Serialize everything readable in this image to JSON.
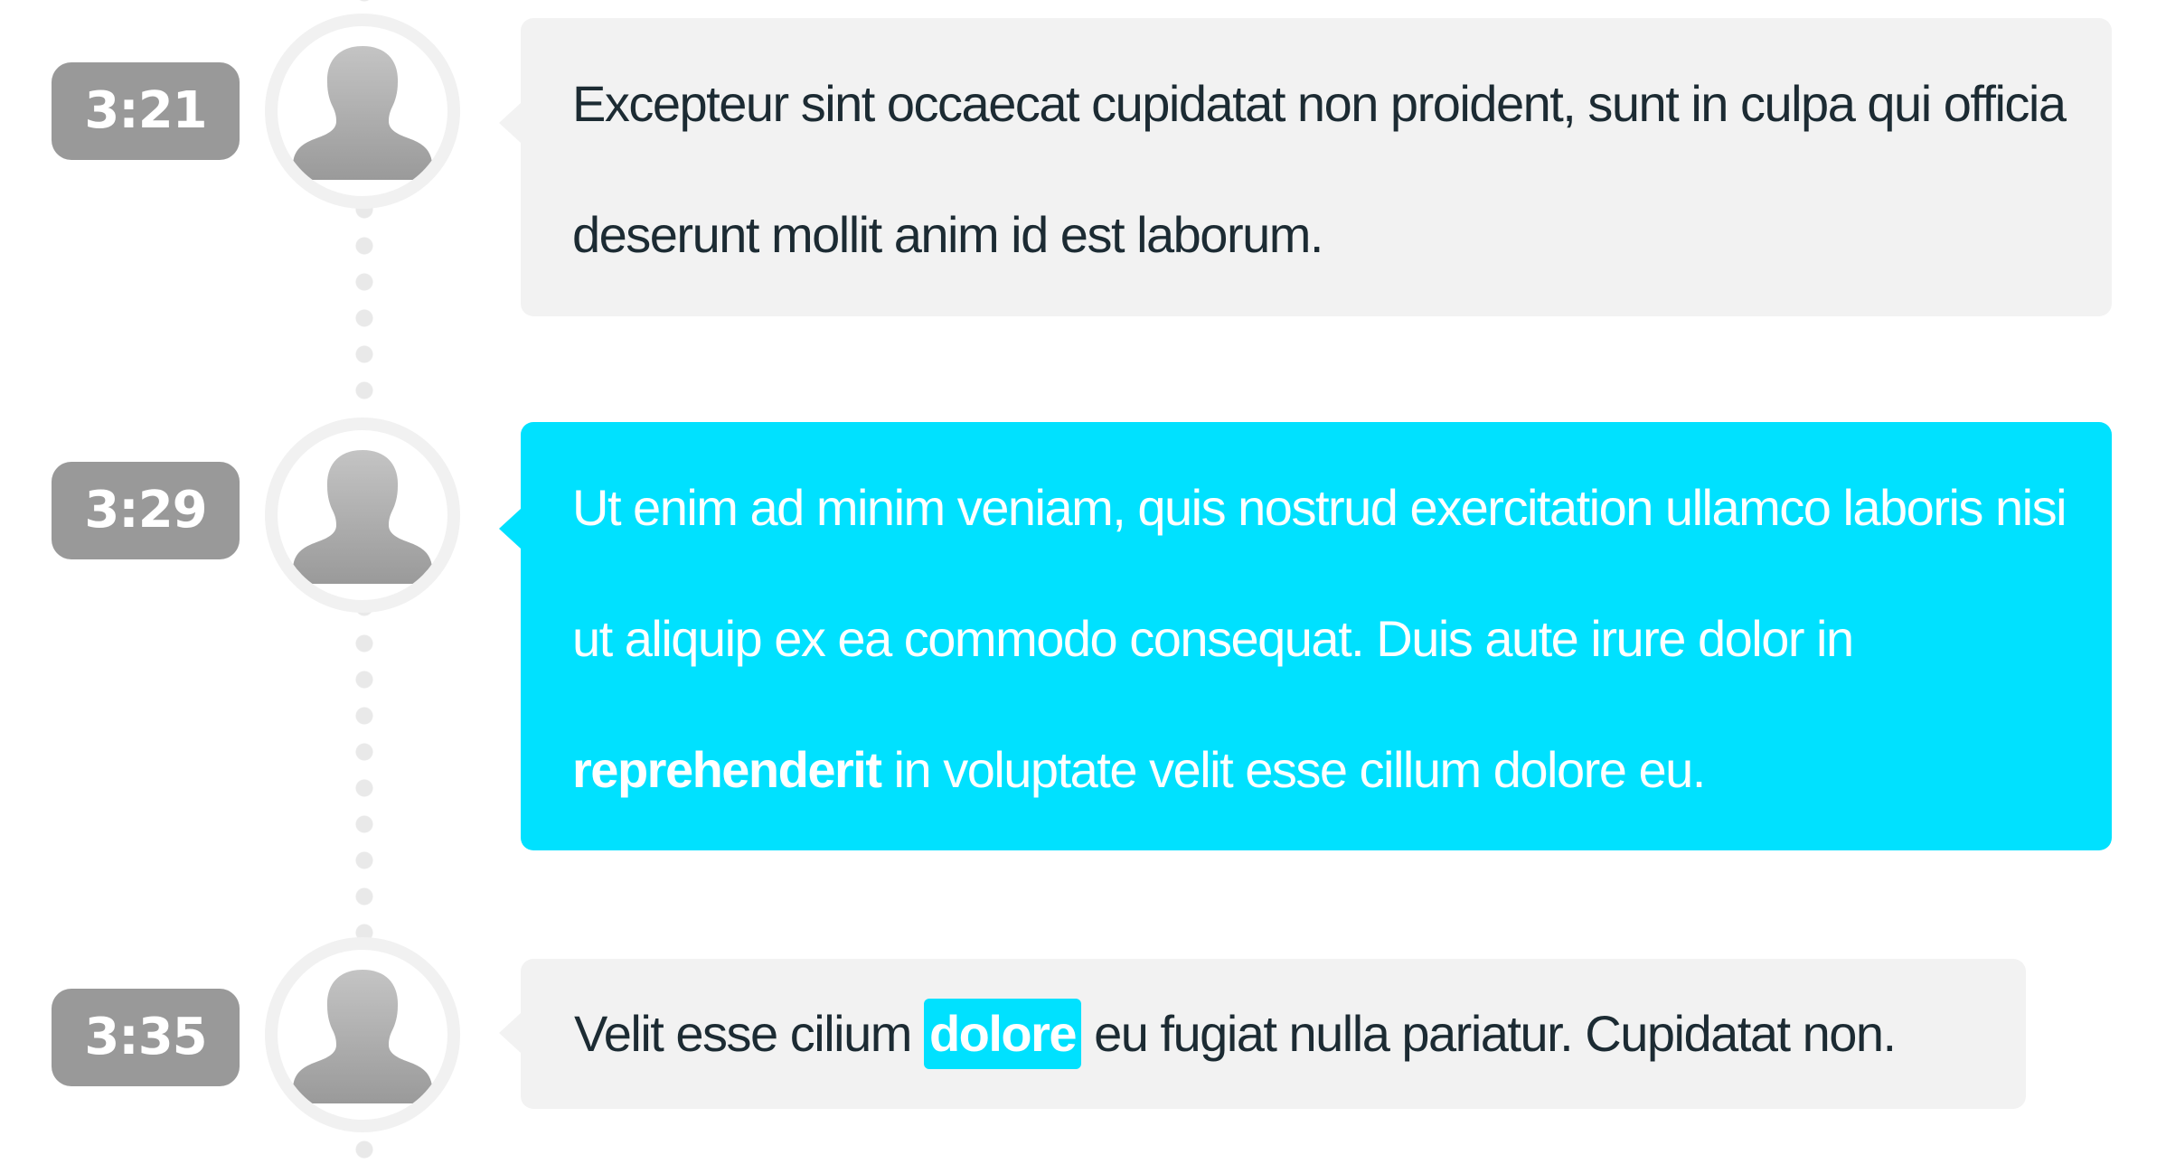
{
  "entries": [
    {
      "time": "3:21",
      "text": "Excepteur sint occaecat cupidatat non proident, sunt in culpa qui officia deserunt mollit anim id est laborum."
    },
    {
      "time": "3:29",
      "text_before": "Ut enim ad minim veniam, quis nostrud exercitation ullamco laboris nisi ut aliquip ex ea commodo consequat. Duis aute irure dolor in ",
      "text_bold": "reprehenderit",
      "text_after": " in voluptate velit esse cillum dolore eu."
    },
    {
      "time": "3:35",
      "text_before": "Velit esse cilium ",
      "text_highlight": "dolore",
      "text_after": " eu fugiat nulla pariatur. Cupidatat non."
    }
  ],
  "colors": {
    "accent": "#00e1ff",
    "bubble_gray": "#f2f2f2",
    "badge_gray": "#999999",
    "text_dark": "#1c2b33"
  },
  "icons": {
    "avatar": "user-silhouette-icon"
  }
}
